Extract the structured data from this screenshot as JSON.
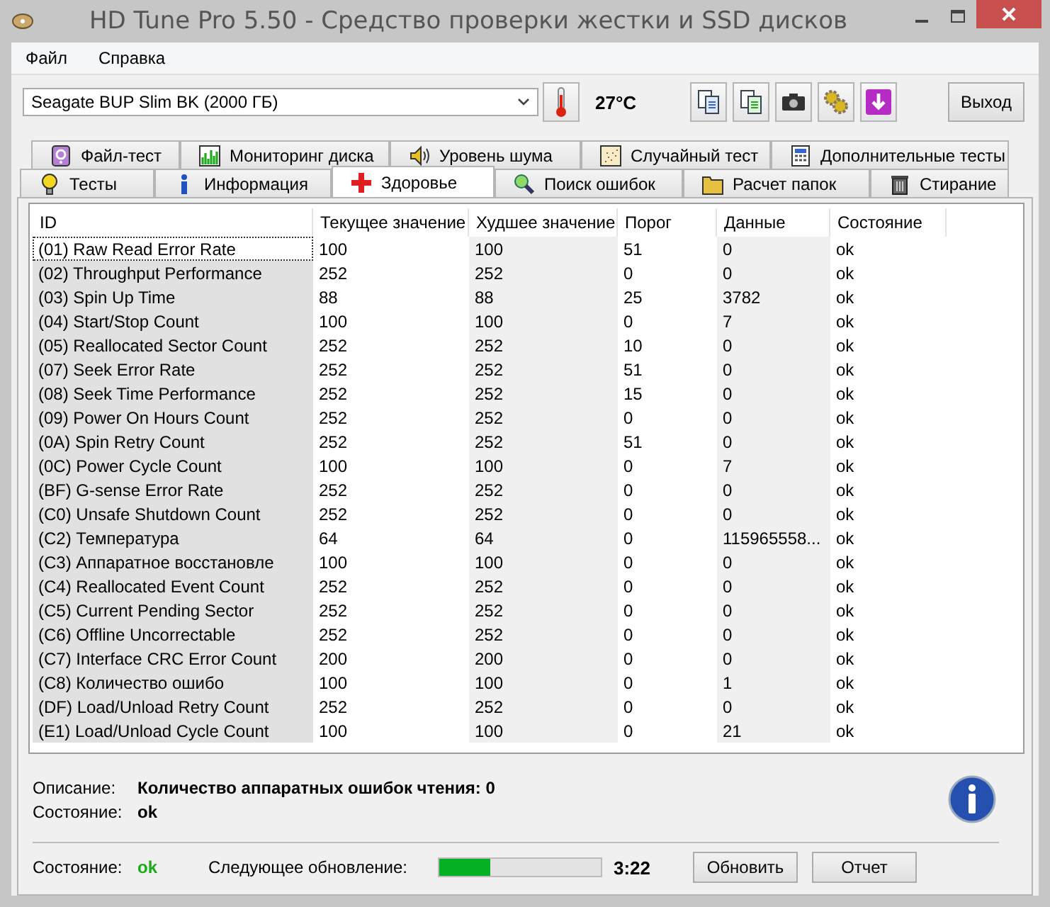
{
  "window": {
    "title": "HD Tune Pro 5.50 - Средство проверки жестки и SSD дисков"
  },
  "menu": [
    "Файл",
    "Справка"
  ],
  "toolbar": {
    "drive": "Seagate BUP Slim BK (2000 ГБ)",
    "temperature": "27°C",
    "exit_button": "Выход"
  },
  "tabs_back": [
    {
      "label": "Файл-тест",
      "selected": false
    },
    {
      "label": "Мониторинг диска",
      "selected": false
    },
    {
      "label": "Уровень шума",
      "selected": false
    },
    {
      "label": "Случайный тест",
      "selected": false
    },
    {
      "label": "Дополнительные тесты",
      "selected": false
    }
  ],
  "tabs_front": [
    {
      "label": "Тесты",
      "selected": false
    },
    {
      "label": "Информация",
      "selected": false
    },
    {
      "label": "Здоровье",
      "selected": true
    },
    {
      "label": "Поиск ошибок",
      "selected": false
    },
    {
      "label": "Расчет папок",
      "selected": false
    },
    {
      "label": "Стирание",
      "selected": false
    }
  ],
  "table": {
    "columns": [
      "ID",
      "Текущее значение",
      "Худшее значение",
      "Порог",
      "Данные",
      "Состояние"
    ],
    "rows": [
      {
        "cells": [
          "(01) Raw Read Error Rate",
          "100",
          "100",
          "51",
          "0",
          "ok"
        ],
        "selected": true
      },
      {
        "cells": [
          "(02) Throughput Performance",
          "252",
          "252",
          "0",
          "0",
          "ok"
        ],
        "selected": false
      },
      {
        "cells": [
          "(03) Spin Up Time",
          "88",
          "88",
          "25",
          "3782",
          "ok"
        ],
        "selected": false
      },
      {
        "cells": [
          "(04) Start/Stop Count",
          "100",
          "100",
          "0",
          "7",
          "ok"
        ],
        "selected": false
      },
      {
        "cells": [
          "(05) Reallocated Sector Count",
          "252",
          "252",
          "10",
          "0",
          "ok"
        ],
        "selected": false
      },
      {
        "cells": [
          "(07) Seek Error Rate",
          "252",
          "252",
          "51",
          "0",
          "ok"
        ],
        "selected": false
      },
      {
        "cells": [
          "(08) Seek Time Performance",
          "252",
          "252",
          "15",
          "0",
          "ok"
        ],
        "selected": false
      },
      {
        "cells": [
          "(09) Power On Hours Count",
          "252",
          "252",
          "0",
          "0",
          "ok"
        ],
        "selected": false
      },
      {
        "cells": [
          "(0A) Spin Retry Count",
          "252",
          "252",
          "51",
          "0",
          "ok"
        ],
        "selected": false
      },
      {
        "cells": [
          "(0C) Power Cycle Count",
          "100",
          "100",
          "0",
          "7",
          "ok"
        ],
        "selected": false
      },
      {
        "cells": [
          "(BF) G-sense Error Rate",
          "252",
          "252",
          "0",
          "0",
          "ok"
        ],
        "selected": false
      },
      {
        "cells": [
          "(C0) Unsafe Shutdown Count",
          "252",
          "252",
          "0",
          "0",
          "ok"
        ],
        "selected": false
      },
      {
        "cells": [
          "(C2) Температура",
          "64",
          "64",
          "0",
          "115965558...",
          "ok"
        ],
        "selected": false
      },
      {
        "cells": [
          "(C3) Аппаратное восстановле",
          "100",
          "100",
          "0",
          "0",
          "ok"
        ],
        "selected": false
      },
      {
        "cells": [
          "(C4) Reallocated Event Count",
          "252",
          "252",
          "0",
          "0",
          "ok"
        ],
        "selected": false
      },
      {
        "cells": [
          "(C5) Current Pending Sector",
          "252",
          "252",
          "0",
          "0",
          "ok"
        ],
        "selected": false
      },
      {
        "cells": [
          "(C6) Offline Uncorrectable",
          "252",
          "252",
          "0",
          "0",
          "ok"
        ],
        "selected": false
      },
      {
        "cells": [
          "(C7) Interface CRC Error Count",
          "200",
          "200",
          "0",
          "0",
          "ok"
        ],
        "selected": false
      },
      {
        "cells": [
          "(C8) Количество ошибо",
          "100",
          "100",
          "0",
          "1",
          "ok"
        ],
        "selected": false
      },
      {
        "cells": [
          "(DF) Load/Unload Retry Count",
          "252",
          "252",
          "0",
          "0",
          "ok"
        ],
        "selected": false
      },
      {
        "cells": [
          "(E1) Load/Unload Cycle Count",
          "100",
          "100",
          "0",
          "21",
          "ok"
        ],
        "selected": false
      }
    ]
  },
  "details": {
    "description_label": "Описание:",
    "description": "Количество аппаратных ошибок чтения: 0",
    "state_label": "Состояние:",
    "state": "ok"
  },
  "status_bar": {
    "state_label": "Состояние:",
    "state": "ok",
    "next_update_label": "Следующее обновление:",
    "level": 0.32,
    "time": "3:22",
    "refresh_button": "Обновить",
    "report_button": "Отчет"
  }
}
